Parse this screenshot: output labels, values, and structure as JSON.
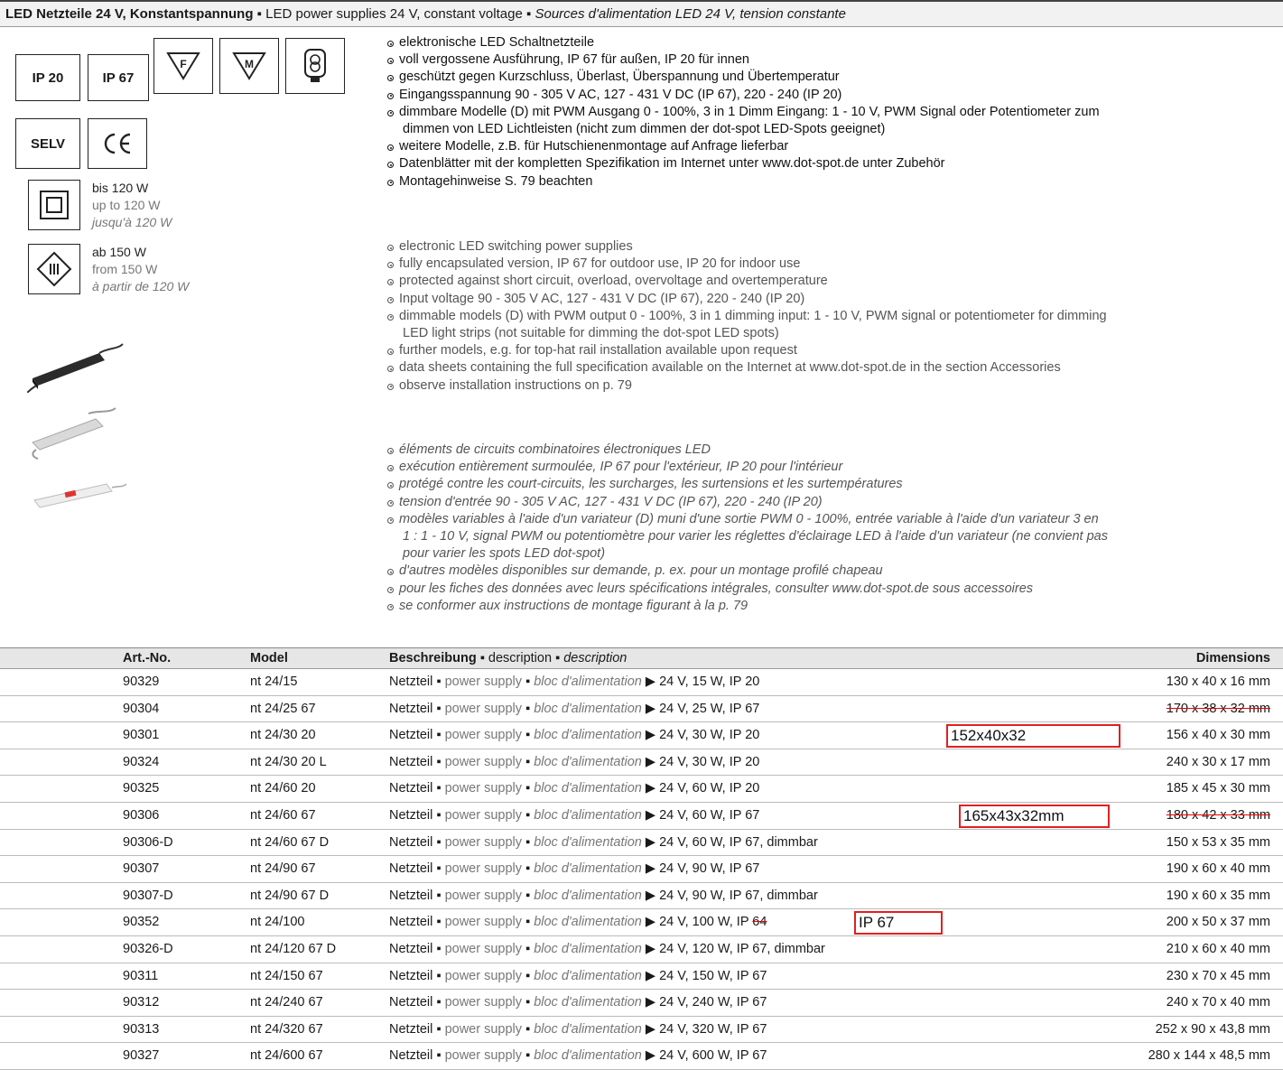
{
  "header": {
    "title_de": "LED Netzteile 24 V, Konstantspannung",
    "title_en": "LED power supplies 24 V, constant voltage",
    "title_fr": "Sources d'alimentation LED 24 V, tension constante"
  },
  "badges": {
    "ip20": "IP 20",
    "ip67": "IP 67",
    "f_mark": "F",
    "m_mark": "M",
    "selv": "SELV",
    "ce": "CE"
  },
  "wattage_notes": {
    "upto": {
      "de": "bis 120 W",
      "en": "up to 120 W",
      "fr": "jusqu'à 120 W"
    },
    "from": {
      "de": "ab 150 W",
      "en": "from 150 W",
      "fr": "à partir de 120 W"
    }
  },
  "bullets_de": [
    "elektronische LED Schaltnetzteile",
    "voll vergossene Ausführung, IP 67 für außen, IP 20 für innen",
    "geschützt gegen Kurzschluss, Überlast, Überspannung und Übertemperatur",
    "Eingangsspannung  90 - 305 V AC, 127 - 431 V DC (IP 67), 220 - 240 (IP 20)",
    "dimmbare Modelle (D) mit PWM Ausgang 0 - 100%, 3 in 1 Dimm Eingang: 1 - 10 V, PWM Signal oder Potentiometer zum",
    "dimmen von LED Lichtleisten (nicht zum dimmen der dot-spot LED-Spots geeignet)",
    "weitere Modelle, z.B. für Hutschienenmontage auf Anfrage lieferbar",
    "Datenblätter mit der kompletten Spezifikation im Internet unter www.dot-spot.de unter Zubehör",
    "Montagehinweise S. 79 beachten"
  ],
  "bullets_en": [
    "electronic LED switching power supplies",
    "fully encapsulated version, IP 67 for outdoor use, IP 20 for indoor use",
    "protected against short circuit, overload, overvoltage and overtemperature",
    "Input voltage 90 - 305 V AC, 127 - 431 V DC (IP 67), 220 - 240 (IP 20)",
    "dimmable models (D) with PWM output 0 - 100%, 3 in 1 dimming input: 1 - 10 V, PWM signal or potentiometer for dimming",
    "LED light strips (not suitable for dimming the dot-spot LED spots)",
    "further models, e.g. for top-hat rail installation available upon request",
    "data sheets containing the full specification available on the Internet at www.dot-spot.de in the section Accessories",
    "observe installation instructions on p. 79"
  ],
  "bullets_fr": [
    "éléments de circuits combinatoires électroniques LED",
    "exécution entièrement surmoulée, IP 67 pour l'extérieur, IP 20 pour l'intérieur",
    "protégé contre les court-circuits, les surcharges, les surtensions et les surtempératures",
    "tension d'entrée  90 - 305 V AC, 127 - 431 V DC (IP 67), 220 - 240 (IP 20)",
    "modèles variables à l'aide d'un variateur (D) muni d'une sortie PWM 0 - 100%, entrée variable à l'aide d'un variateur 3 en",
    "1 : 1 - 10 V, signal PWM ou potentiomètre pour varier les réglettes d'éclairage LED à l'aide d'un variateur (ne convient pas",
    "pour varier les spots LED dot-spot)",
    "d'autres modèles disponibles sur demande, p. ex. pour un montage profilé chapeau",
    "pour les fiches des données avec leurs spécifications intégrales, consulter www.dot-spot.de sous accessoires",
    "se conformer aux instructions de montage figurant à la p. 79"
  ],
  "table": {
    "col_art": "Art.-No.",
    "col_model": "Model",
    "col_desc_de": "Beschreibung",
    "col_desc_en": "description",
    "col_desc_fr": "description",
    "col_dim": "Dimensions",
    "desc_prefix": {
      "de": "Netzteil",
      "en": "power supply",
      "fr": "bloc d'alimentation"
    },
    "rows": [
      {
        "art": "90329",
        "model": "nt 24/15",
        "spec": "24 V, 15 W, IP 20",
        "dim": "130 x 40 x 16 mm"
      },
      {
        "art": "90304",
        "model": "nt 24/25 67",
        "spec": "24 V, 25 W, IP 67",
        "dim": "170 x 38 x 32 mm"
      },
      {
        "art": "90301",
        "model": "nt 24/30 20",
        "spec": "24 V, 30 W, IP 20",
        "dim": "156 x 40 x 30 mm",
        "note": "152x40x32"
      },
      {
        "art": "90324",
        "model": "nt 24/30 20 L",
        "spec": "24 V, 30 W, IP 20",
        "dim": "240 x 30 x 17 mm"
      },
      {
        "art": "90325",
        "model": "nt 24/60 20",
        "spec": "24 V, 60 W, IP 20",
        "dim": "185 x 45 x 30 mm"
      },
      {
        "art": "90306",
        "model": "nt 24/60 67",
        "spec": "24 V, 60 W, IP 67",
        "dim": "180 x 42 x 33 mm",
        "note": "165x43x32mm"
      },
      {
        "art": "90306-D",
        "model": "nt 24/60 67 D",
        "spec": "24 V, 60 W, IP 67, dimmbar",
        "dim": "150 x 53 x 35 mm"
      },
      {
        "art": "90307",
        "model": "nt 24/90 67",
        "spec": "24 V, 90 W, IP 67",
        "dim": "190 x 60 x 40 mm"
      },
      {
        "art": "90307-D",
        "model": "nt 24/90 67 D",
        "spec": "24 V, 90 W, IP 67, dimmbar",
        "dim": "190 x 60 x 35 mm"
      },
      {
        "art": "90352",
        "model": "nt 24/100",
        "spec": "24 V, 100 W, IP",
        "spec_struck": "64",
        "dim": "200 x 50 x 37 mm",
        "note": "IP 67"
      },
      {
        "art": "90326-D",
        "model": "nt 24/120 67 D",
        "spec": "24 V, 120 W, IP 67, dimmbar",
        "dim": "210 x 60 x 40 mm"
      },
      {
        "art": "90311",
        "model": "nt 24/150 67",
        "spec": "24 V, 150 W, IP 67",
        "dim": "230 x 70 x 45 mm"
      },
      {
        "art": "90312",
        "model": "nt 24/240 67",
        "spec": "24 V, 240 W, IP 67",
        "dim": "240 x 70 x 40 mm"
      },
      {
        "art": "90313",
        "model": "nt 24/320 67",
        "spec": "24 V, 320 W, IP 67",
        "dim": "252 x 90 x 43,8 mm"
      },
      {
        "art": "90327",
        "model": "nt 24/600 67",
        "spec": "24 V, 600 W, IP 67",
        "dim": "280 x 144 x 48,5 mm"
      }
    ]
  },
  "colors": {
    "annotation_red": "#e02020",
    "strike_red": "#e00000",
    "header_bg": "#f2f2f2",
    "table_head_bg": "#e6e6e6"
  }
}
